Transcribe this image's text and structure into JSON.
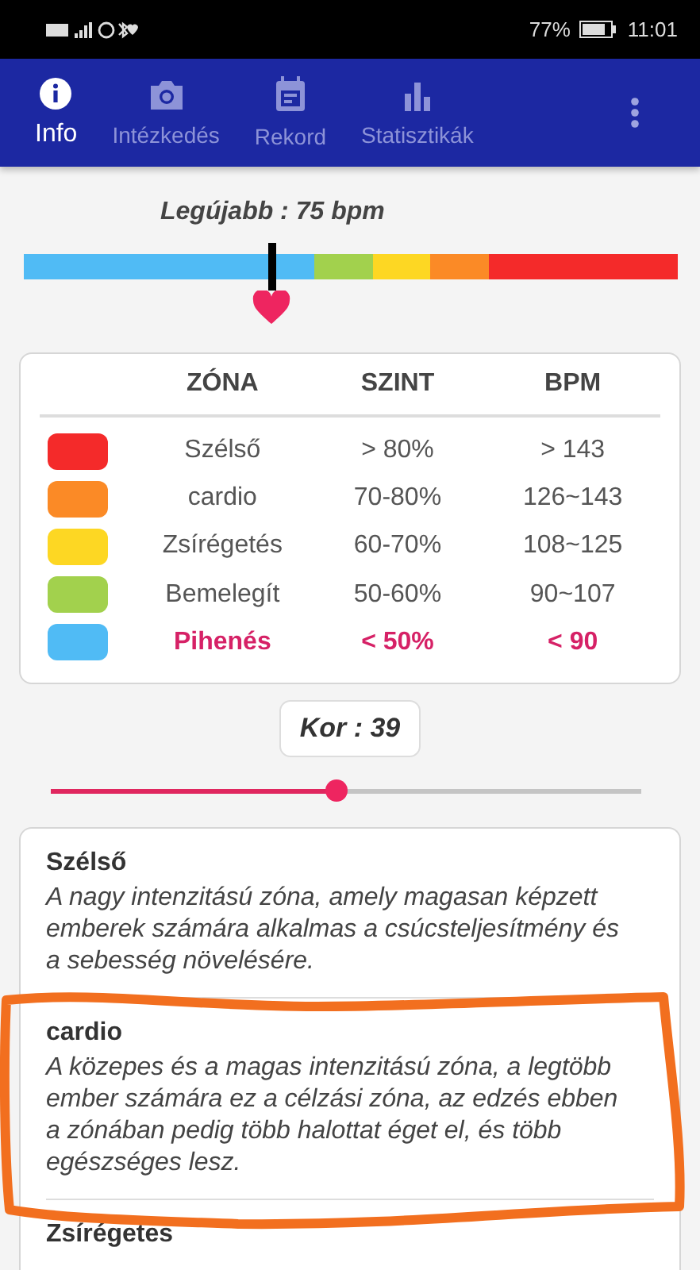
{
  "status_bar": {
    "battery": "77%",
    "time": "11:01"
  },
  "tabs": [
    {
      "label": "Info",
      "selected": true
    },
    {
      "label": "Intézkedés",
      "selected": false
    },
    {
      "label": "Rekord",
      "selected": false
    },
    {
      "label": "Statisztikák",
      "selected": false
    }
  ],
  "latest": {
    "label": "Legújabb : 75 bpm",
    "level": 0.379
  },
  "zone_table": {
    "columns": [
      "ZÓNA",
      "SZINT",
      "BPM"
    ],
    "rows": [
      {
        "color": "#f42a2a",
        "zone": "Szélső",
        "level_range": "> 80%",
        "bpm": "> 143",
        "selected": false
      },
      {
        "color": "#fb8a26",
        "zone": "cardio",
        "level_range": "70-80%",
        "bpm": "126~143",
        "selected": false
      },
      {
        "color": "#fdd723",
        "zone": "Zsírégetés",
        "level_range": "60-70%",
        "bpm": "108~125",
        "selected": false
      },
      {
        "color": "#a2d14d",
        "zone": "Bemelegít",
        "level_range": "50-60%",
        "bpm": "90~107",
        "selected": false
      },
      {
        "color": "#50bbf5",
        "zone": "Pihenés",
        "level_range": "< 50%",
        "bpm": "< 90",
        "selected": true
      }
    ]
  },
  "age": {
    "label": "Kor : 39",
    "level": 0.485
  },
  "descriptions": [
    {
      "title": "Szélső",
      "text": "A nagy intenzitású zóna, amely magasan képzett emberek számára alkalmas a csúcsteljesítmény és a sebesség növelésére."
    },
    {
      "title": "cardio",
      "text": "A közepes és a magas intenzitású zóna, a legtöbb ember számára ez a célzási zóna, az edzés ebben a zónában pedig több halottat éget el, és több egészséges lesz."
    },
    {
      "title": "Zsírégetes"
    }
  ]
}
